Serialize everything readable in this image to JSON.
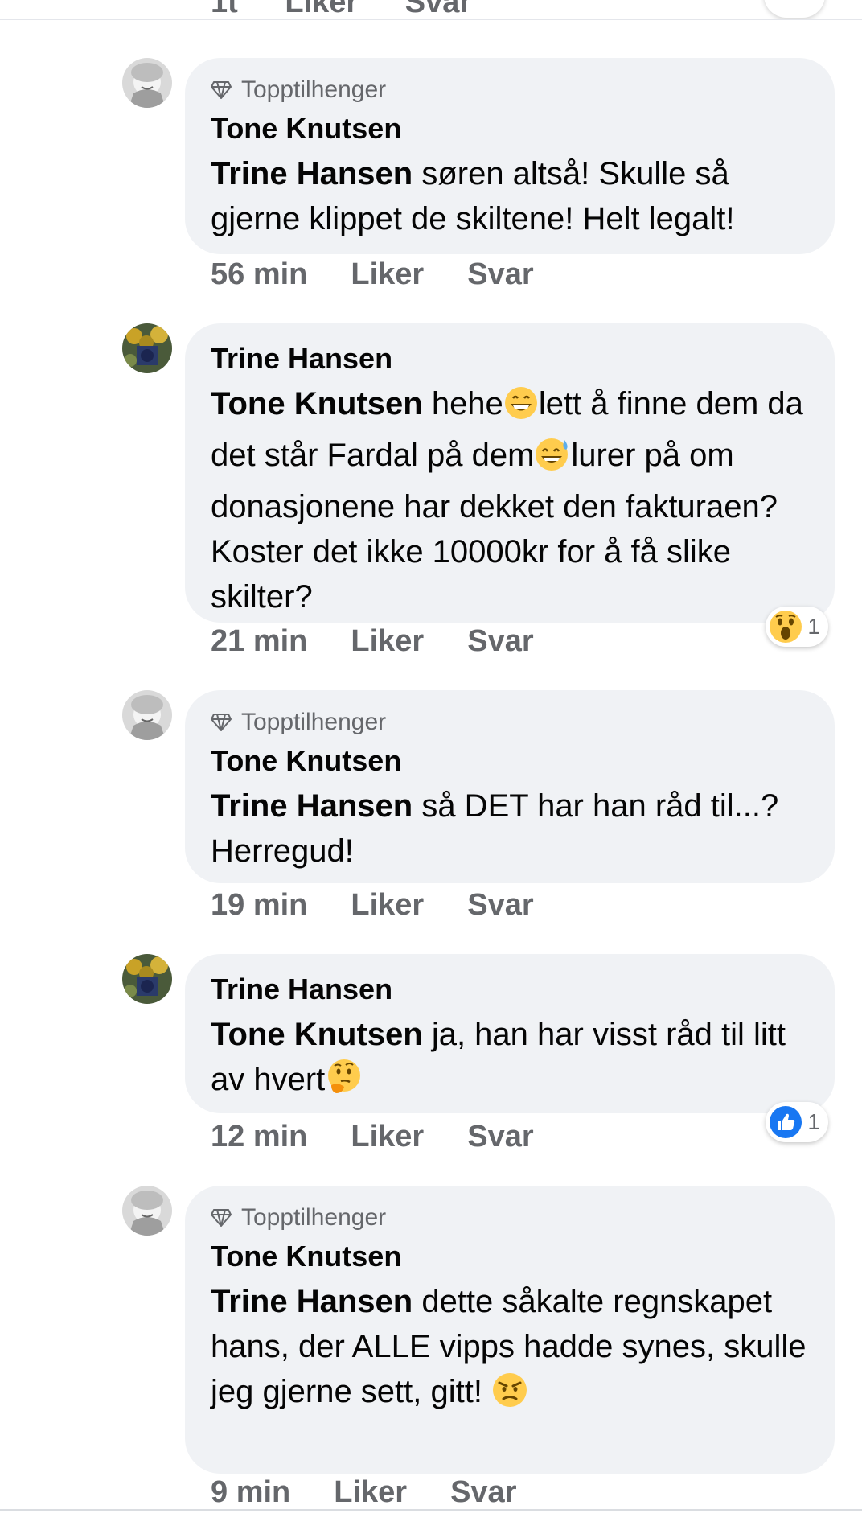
{
  "top_partial": {
    "time": "1t",
    "like": "Liker",
    "reply": "Svar"
  },
  "comments": [
    {
      "avatar": "tone-avatar",
      "badge": "Topptilhenger",
      "author": "Tone Knutsen",
      "mention": "Trine Hansen",
      "text": " søren altså! Skulle så gjerne klippet de skiltene! Helt legalt!",
      "time": "56 min",
      "like": "Liker",
      "reply": "Svar"
    },
    {
      "avatar": "trine-avatar",
      "badge": "",
      "author": "Trine Hansen",
      "mention": "Tone Knutsen",
      "text_parts": [
        " hehe",
        "lett å finne dem da det står Fardal på dem",
        "lurer på om donasjonene har dekket den fakturaen? Koster det ikke 10000kr for å få slike skilter?"
      ],
      "emojis": [
        "grinning-face",
        "grinning-sweat-face"
      ],
      "time": "21 min",
      "like": "Liker",
      "reply": "Svar",
      "reaction": {
        "icon": "wow-reaction-icon",
        "count": "1"
      }
    },
    {
      "avatar": "tone-avatar",
      "badge": "Topptilhenger",
      "author": "Tone Knutsen",
      "mention": "Trine Hansen",
      "text": " så DET har han råd til...? Herregud!",
      "time": "19 min",
      "like": "Liker",
      "reply": "Svar"
    },
    {
      "avatar": "trine-avatar",
      "badge": "",
      "author": "Trine Hansen",
      "mention": "Tone Knutsen",
      "text": " ja, han har visst råd til litt av hvert",
      "emojis": [
        "thinking-face"
      ],
      "time": "12 min",
      "like": "Liker",
      "reply": "Svar",
      "reaction": {
        "icon": "like-reaction-icon",
        "count": "1"
      }
    },
    {
      "avatar": "tone-avatar",
      "badge": "Topptilhenger",
      "author": "Tone Knutsen",
      "mention": "Trine Hansen",
      "text": " dette såkalte regnskapet hans, der ALLE vipps hadde synes, skulle jeg gjerne sett, gitt! ",
      "emojis": [
        "angry-face"
      ],
      "time": "9 min",
      "like": "Liker",
      "reply": "Svar"
    }
  ],
  "colors": {
    "bubble": "#f0f2f5",
    "meta_text": "#65676b",
    "text": "#050505",
    "like_blue": "#1877f2",
    "emoji_yellow": "#ffcc4d"
  }
}
